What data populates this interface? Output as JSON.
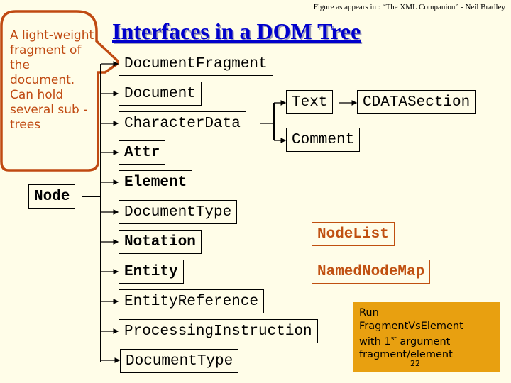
{
  "caption": "Figure as appears in : “The XML Companion” - Neil Bradley",
  "title": "Interfaces in a DOM Tree",
  "callout": {
    "text": "A light-weight fragment of the document. Can hold several sub -trees",
    "color": "#c04a12"
  },
  "tree": {
    "root": "Node",
    "children": [
      "DocumentFragment",
      "Document",
      "CharacterData",
      "Attr",
      "Element",
      "DocumentType",
      "Notation",
      "Entity",
      "EntityReference",
      "ProcessingInstruction",
      "DocumentType"
    ],
    "characterdata_children": [
      "Text",
      "Comment"
    ],
    "text_children": [
      "CDATASection"
    ]
  },
  "other_interfaces": [
    "NodeList",
    "NamedNodeMap"
  ],
  "note": {
    "line1": "Run",
    "line2": "FragmentVsElement",
    "line3_pre": "with 1",
    "line3_sup": "st",
    "line3_post": " argument",
    "line4": "fragment/element",
    "background": "#e8a010"
  },
  "page_number": "22"
}
